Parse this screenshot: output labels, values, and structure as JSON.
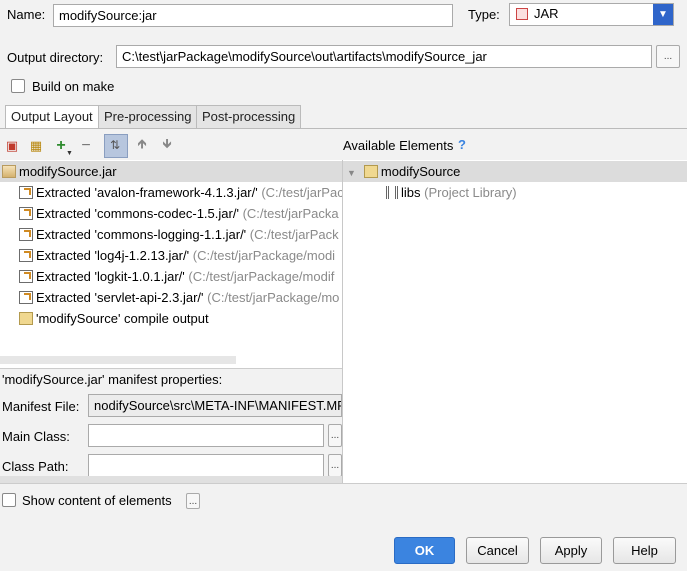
{
  "name_label": "Name:",
  "name_value": "modifySource:jar",
  "type_label": "Type:",
  "type_value": "JAR",
  "output_dir_label": "Output directory:",
  "output_dir_value": "C:\\test\\jarPackage\\modifySource\\out\\artifacts\\modifySource_jar",
  "browse_label": "...",
  "build_on_make": "Build on make",
  "tabs": [
    "Output Layout",
    "Pre-processing",
    "Post-processing"
  ],
  "available_elements": "Available Elements",
  "help_q": "?",
  "tree_root": "modifySource.jar",
  "tree_items": [
    {
      "main": "Extracted 'avalon-framework-4.1.3.jar/'",
      "path": "(C:/test/jarPack"
    },
    {
      "main": "Extracted 'commons-codec-1.5.jar/'",
      "path": "(C:/test/jarPacka"
    },
    {
      "main": "Extracted 'commons-logging-1.1.jar/'",
      "path": "(C:/test/jarPack"
    },
    {
      "main": "Extracted 'log4j-1.2.13.jar/'",
      "path": "(C:/test/jarPackage/modi"
    },
    {
      "main": "Extracted 'logkit-1.0.1.jar/'",
      "path": "(C:/test/jarPackage/modif"
    },
    {
      "main": "Extracted 'servlet-api-2.3.jar/'",
      "path": "(C:/test/jarPackage/mo"
    }
  ],
  "compile_output": "'modifySource' compile output",
  "avail_root": "modifySource",
  "avail_libs": "libs",
  "avail_libs_note": "(Project Library)",
  "manifest_title": "'modifySource.jar' manifest properties:",
  "manifest_file_label": "Manifest File:",
  "manifest_file_value": "nodifySource\\src\\META-INF\\MANIFEST.MF",
  "main_class_label": "Main Class:",
  "class_path_label": "Class Path:",
  "show_content": "Show content of elements",
  "buttons": {
    "ok": "OK",
    "cancel": "Cancel",
    "apply": "Apply",
    "help": "Help"
  },
  "colors": {
    "accent": "#3b84e0",
    "combo_arrow": "#2f65ca",
    "selected_toolbar": "#b7c6de"
  }
}
